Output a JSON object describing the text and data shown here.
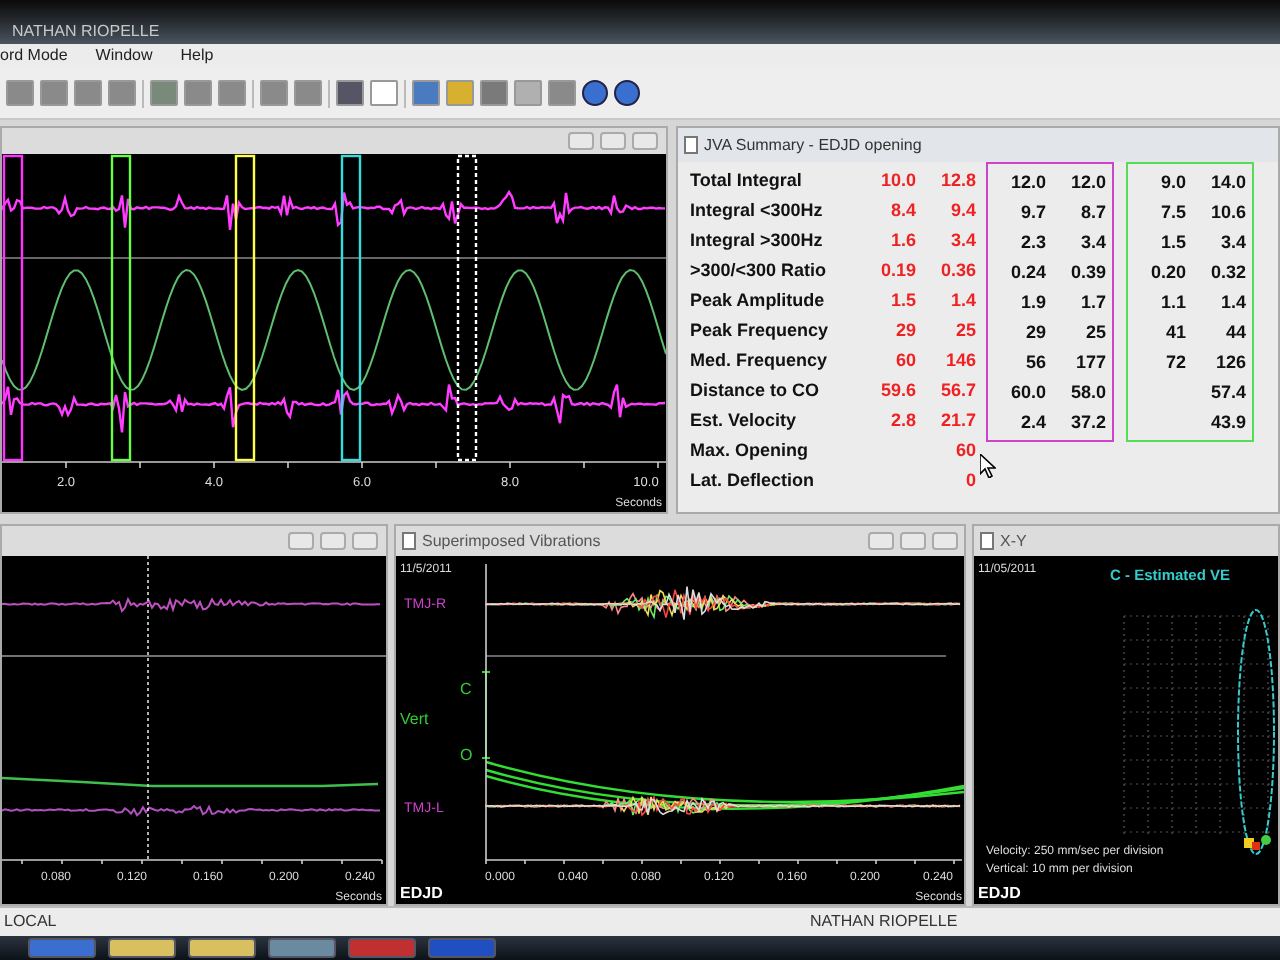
{
  "title_bar": {
    "title": "NATHAN RIOPELLE"
  },
  "menu": [
    "ord Mode",
    "Window",
    "Help"
  ],
  "timeline_panel": {
    "axis_labels": [
      "2.0",
      "4.0",
      "6.0",
      "8.0",
      "10.0"
    ],
    "axis_unit": "Seconds",
    "markers": [
      {
        "color": "#ff33ff"
      },
      {
        "color": "#66ff44"
      },
      {
        "color": "#ffff44"
      },
      {
        "color": "#33dddd"
      },
      {
        "color": "#ffffff"
      }
    ]
  },
  "summary_panel": {
    "title": "JVA Summary - EDJD opening",
    "groups": [
      {
        "kind": "text",
        "color": "#ee2222"
      },
      {
        "kind": "frame",
        "color": "#cc44cc"
      },
      {
        "kind": "frame",
        "color": "#55dd55"
      }
    ],
    "rows": [
      {
        "label": "Total Integral",
        "values": [
          [
            "10.0",
            "12.8"
          ],
          [
            "12.0",
            "12.0"
          ],
          [
            "9.0",
            "14.0"
          ]
        ]
      },
      {
        "label": "Integral <300Hz",
        "values": [
          [
            "8.4",
            "9.4"
          ],
          [
            "9.7",
            "8.7"
          ],
          [
            "7.5",
            "10.6"
          ]
        ]
      },
      {
        "label": "Integral >300Hz",
        "values": [
          [
            "1.6",
            "3.4"
          ],
          [
            "2.3",
            "3.4"
          ],
          [
            "1.5",
            "3.4"
          ]
        ]
      },
      {
        "label": ">300/<300 Ratio",
        "values": [
          [
            "0.19",
            "0.36"
          ],
          [
            "0.24",
            "0.39"
          ],
          [
            "0.20",
            "0.32"
          ]
        ]
      },
      {
        "label": "Peak Amplitude",
        "values": [
          [
            "1.5",
            "1.4"
          ],
          [
            "1.9",
            "1.7"
          ],
          [
            "1.1",
            "1.4"
          ]
        ]
      },
      {
        "label": "Peak Frequency",
        "values": [
          [
            "29",
            "25"
          ],
          [
            "29",
            "25"
          ],
          [
            "41",
            "44"
          ]
        ]
      },
      {
        "label": "Med. Frequency",
        "values": [
          [
            "60",
            "146"
          ],
          [
            "56",
            "177"
          ],
          [
            "72",
            "126"
          ]
        ]
      },
      {
        "label": "Distance to CO",
        "values": [
          [
            "59.6",
            "56.7"
          ],
          [
            "60.0",
            "58.0"
          ],
          [
            "57.4"
          ]
        ]
      },
      {
        "label": "Est. Velocity",
        "values": [
          [
            "2.8",
            "21.7"
          ],
          [
            "2.4",
            "37.2"
          ],
          [
            "43.9"
          ]
        ]
      },
      {
        "label": "Max. Opening",
        "values": [
          [
            "60"
          ]
        ]
      },
      {
        "label": "Lat. Deflection",
        "values": [
          [
            "0"
          ]
        ]
      }
    ]
  },
  "trace_panel": {
    "axis_labels": [
      "0.080",
      "0.120",
      "0.160",
      "0.200",
      "0.240"
    ],
    "axis_unit": "Seconds"
  },
  "superimposed_panel": {
    "title": "Superimposed Vibrations",
    "date": "11/5/2011",
    "top_channel": "TMJ-R",
    "bottom_channel": "TMJ-L",
    "scale_top": "C",
    "scale_label": "Vert",
    "scale_bottom": "O",
    "axis_labels": [
      "0.000",
      "0.040",
      "0.080",
      "0.120",
      "0.160",
      "0.200",
      "0.240"
    ],
    "axis_unit": "Seconds",
    "footer": "EDJD"
  },
  "xy_panel": {
    "title": "X-Y",
    "date": "11/05/2011",
    "legend": "C - Estimated VE",
    "notes": [
      "Velocity: 250 mm/sec per division",
      "Vertical: 10 mm per division"
    ],
    "footer": "EDJD"
  },
  "status_bar": {
    "left": "LOCAL",
    "right": "NATHAN RIOPELLE"
  }
}
